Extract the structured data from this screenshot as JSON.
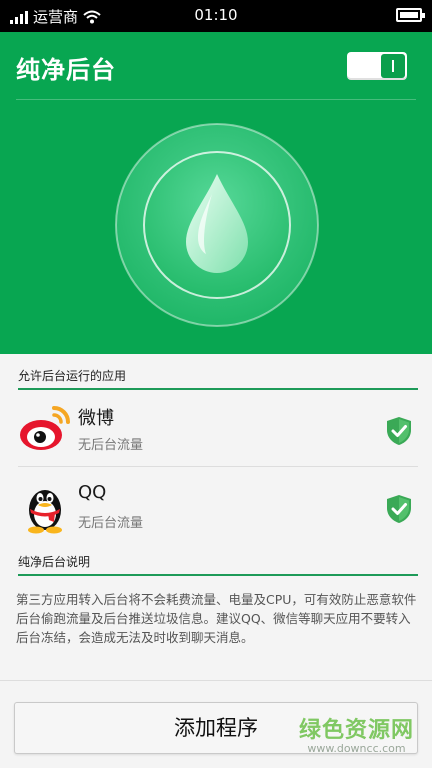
{
  "status_bar": {
    "carrier": "运营商",
    "time": "01:10"
  },
  "header": {
    "title": "纯净后台",
    "toggle_on": true
  },
  "allowed_section": {
    "title": "允许后台运行的应用",
    "apps": [
      {
        "name": "微博",
        "status": "无后台流量",
        "icon": "weibo-icon"
      },
      {
        "name": "QQ",
        "status": "无后台流量",
        "icon": "qq-penguin-icon"
      }
    ]
  },
  "info_section": {
    "title": "纯净后台说明",
    "text": "第三方应用转入后台将不会耗费流量、电量及CPU，可有效防止恶意软件后台偷跑流量及后台推送垃圾信息。建议QQ、微信等聊天应用不要转入后台冻结，会造成无法及时收到聊天消息。"
  },
  "footer": {
    "add_button": "添加程序"
  },
  "watermark": {
    "main": "绿色资源网",
    "url": "www.downcc.com"
  },
  "colors": {
    "brand_green": "#08a651",
    "shield_green": "#3aa956"
  }
}
